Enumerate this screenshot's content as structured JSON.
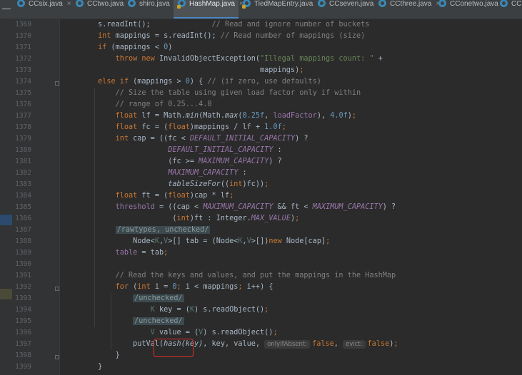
{
  "tabs": [
    {
      "label": "CCsix.java",
      "active": false,
      "locked": false
    },
    {
      "label": "CCtwo.java",
      "active": false,
      "locked": false
    },
    {
      "label": "shiro.java",
      "active": false,
      "locked": false
    },
    {
      "label": "HashMap.java",
      "active": true,
      "locked": true
    },
    {
      "label": "TiedMapEntry.java",
      "active": false,
      "locked": true
    },
    {
      "label": "CCseven.java",
      "active": false,
      "locked": false
    },
    {
      "label": "CCthree.java",
      "active": false,
      "locked": false
    },
    {
      "label": "CConetwo.java",
      "active": false,
      "locked": false
    },
    {
      "label": "CC",
      "active": false,
      "locked": false
    }
  ],
  "editor": {
    "line_numbers": [
      "1369",
      "1370",
      "1371",
      "1372",
      "1373",
      "1374",
      "1375",
      "1376",
      "1377",
      "1378",
      "1379",
      "1380",
      "1381",
      "1382",
      "1383",
      "1384",
      "1385",
      "1386",
      "1387",
      "1388",
      "1389",
      "1390",
      "1391",
      "1392",
      "1393",
      "1394",
      "1395",
      "1396",
      "1397",
      "1398",
      "1399"
    ],
    "hints": {
      "only_if_absent": "onlyIfAbsent:",
      "evict": "evict:"
    },
    "annotations": {
      "rawtypes": "/rawtypes, unchecked/",
      "unchecked": "/unchecked/"
    },
    "highlight": "hash(key)",
    "colors": {
      "keyword": "#cc7832",
      "number": "#6897bb",
      "string": "#6a8759",
      "comment": "#808080",
      "constant": "#9876aa",
      "highlight_box": "#e0302a",
      "active_tab_underline": "#4a88c7"
    }
  }
}
